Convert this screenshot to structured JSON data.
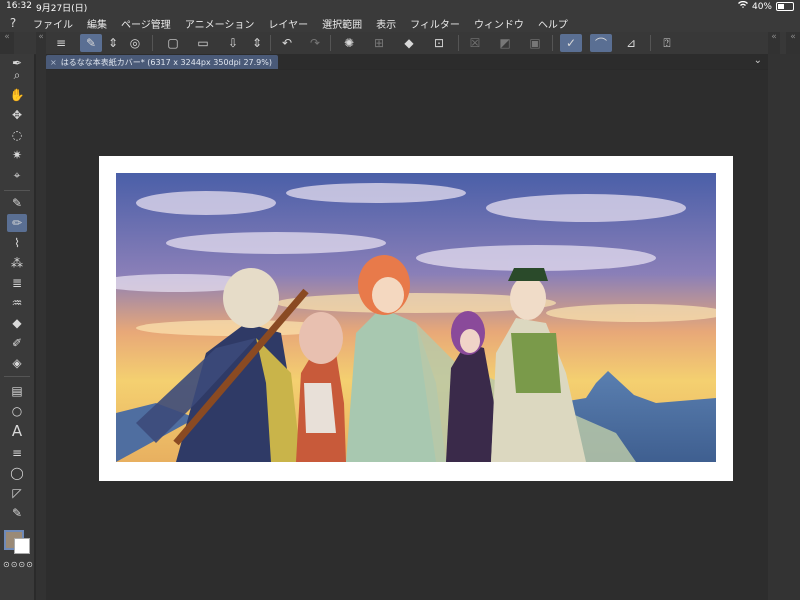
{
  "status_bar": {
    "time": "16:32",
    "date": "9月27日(日)",
    "wifi_icon": "wifi-icon",
    "battery": "40%",
    "battery_level": 0.4
  },
  "menu": {
    "items": [
      "ファイル",
      "編集",
      "ページ管理",
      "アニメーション",
      "レイヤー",
      "選択範囲",
      "表示",
      "フィルター",
      "ウィンドウ",
      "ヘルプ"
    ]
  },
  "tab": {
    "title": "はるなな本表紙カバー* (6317 x 3244px 350dpi 27.9%)"
  },
  "dock": {
    "collapse_left": "«",
    "collapse_right": "«",
    "expand_chevron": "⌄"
  },
  "colors": {
    "main_color": "#9a8a77",
    "sub_color": "#ffffff",
    "accent": "#5a6f93"
  },
  "toolbar_icons": [
    "menu-icon",
    "edit-icon",
    "updown-icon",
    "rotate-icon",
    "new-icon",
    "open-icon",
    "save-icon",
    "updown-icon",
    "undo-icon",
    "redo-icon",
    "loading-icon",
    "transform-icon",
    "fill-icon",
    "crop-icon",
    "checkbox-icon",
    "layer-icon",
    "frame-icon",
    "pen-correct-icon",
    "brush-correct-icon",
    "ruler-icon",
    "help-icon"
  ],
  "tools": [
    "pen-icon",
    "zoom-icon",
    "hand-icon",
    "move-icon",
    "lasso-icon",
    "auto-select-icon",
    "eyedropper-icon",
    "pen-tool-icon",
    "pencil-icon",
    "brush-icon",
    "airbrush-icon",
    "decoration-icon",
    "eraser-icon",
    "blend-icon",
    "fill-tool-icon",
    "gradient-icon",
    "shape-icon",
    "text-icon",
    "frame-icon",
    "balloon-icon",
    "line-icon",
    "correct-icon"
  ]
}
